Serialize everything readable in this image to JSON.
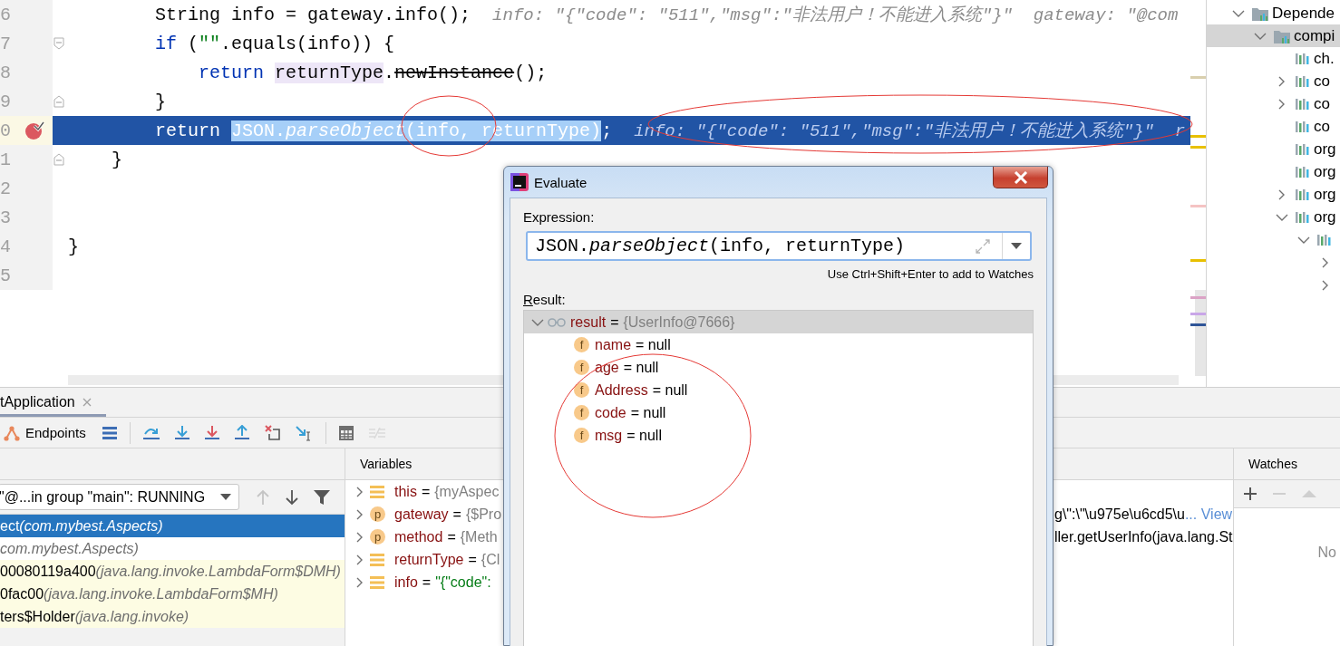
{
  "editor": {
    "lines": [
      {
        "number": "6",
        "current": false,
        "breakpoint": false,
        "fold_open": false,
        "fold_close": false,
        "code": [
          {
            "text": "        String info = gateway.info();",
            "kind": "plain"
          }
        ],
        "hint": "info: \"{\"code\": \"511\",\"msg\":\"非法用户！不能进入系统\"}\"  gateway: \"@com"
      },
      {
        "number": "7",
        "current": false,
        "breakpoint": false,
        "fold_open": true,
        "fold_close": false,
        "code": [
          {
            "text": "        if",
            "kind": "keyword"
          },
          {
            "text": " (",
            "kind": "plain"
          },
          {
            "text": "\"\"",
            "kind": "string"
          },
          {
            "text": ".equals(info)) {",
            "kind": "plain"
          }
        ]
      },
      {
        "number": "8",
        "current": false,
        "breakpoint": false,
        "fold_open": false,
        "fold_close": false,
        "code": [
          {
            "text": "            return ",
            "kind": "keyword"
          },
          {
            "text": "returnType",
            "kind": "usage"
          },
          {
            "text": ".",
            "kind": "plain"
          },
          {
            "text": "newInstance",
            "kind": "deprecated"
          },
          {
            "text": "();",
            "kind": "plain"
          }
        ]
      },
      {
        "number": "9",
        "current": false,
        "breakpoint": false,
        "fold_open": false,
        "fold_close": true,
        "code": [
          {
            "text": "        }",
            "kind": "plain"
          }
        ]
      },
      {
        "number": "0",
        "current": true,
        "breakpoint": true,
        "fold_open": false,
        "fold_close": false,
        "code": [
          {
            "text": "        return ",
            "kind": "keyword"
          },
          {
            "text": "JSON.*parseObject*(info, returnType)",
            "kind": "selection"
          },
          {
            "text": ";",
            "kind": "plain"
          }
        ],
        "hint": "info: \"{\"code\": \"511\",\"msg\":\"非法用户！不能进入系统\"}\"  r"
      },
      {
        "number": "1",
        "current": false,
        "breakpoint": false,
        "fold_open": false,
        "fold_close": true,
        "code": [
          {
            "text": "    }",
            "kind": "plain"
          }
        ]
      },
      {
        "number": "2",
        "current": false,
        "breakpoint": false,
        "fold_open": false,
        "fold_close": false
      },
      {
        "number": "3",
        "current": false,
        "breakpoint": false,
        "fold_open": false,
        "fold_close": false
      },
      {
        "number": "4",
        "current": false,
        "breakpoint": false,
        "fold_open": false,
        "fold_close": false,
        "code": [
          {
            "text": "}",
            "kind": "plain"
          }
        ]
      },
      {
        "number": "5",
        "current": false,
        "breakpoint": false,
        "fold_open": false,
        "fold_close": false
      }
    ]
  },
  "project_tree": {
    "items": [
      {
        "label": "Depende",
        "kind": "folder",
        "expanded": true,
        "selected": false,
        "children": [
          {
            "label": "compi",
            "kind": "folder",
            "expanded": true,
            "selected": true,
            "children": [
              {
                "label": "ch.",
                "kind": "library",
                "selected": false
              },
              {
                "label": "co",
                "kind": "library",
                "expanded": false,
                "selected": false
              },
              {
                "label": "co",
                "kind": "library",
                "expanded": false,
                "selected": false
              },
              {
                "label": "co",
                "kind": "library",
                "selected": false
              },
              {
                "label": "org",
                "kind": "library",
                "selected": false
              },
              {
                "label": "org",
                "kind": "library",
                "selected": false
              },
              {
                "label": "org",
                "kind": "library",
                "expanded": false,
                "selected": false
              },
              {
                "label": "org",
                "kind": "library",
                "expanded": true,
                "selected": false,
                "children": [
                  {
                    "kind": "library",
                    "expanded": true,
                    "selected": false,
                    "children": [
                      {
                        "expanded": false,
                        "selected": false
                      },
                      {
                        "expanded": false,
                        "selected": false
                      }
                    ]
                  }
                ]
              }
            ]
          }
        ]
      }
    ]
  },
  "run_tab": {
    "label": "tApplication"
  },
  "debug_toolbar": [
    {
      "kind": "endpoints",
      "label": "Endpoints",
      "disabled": false
    },
    {
      "kind": "threads",
      "disabled": false
    },
    {
      "kind": "separator"
    },
    {
      "kind": "step_over",
      "disabled": false
    },
    {
      "kind": "step_into",
      "disabled": false
    },
    {
      "kind": "force_step_into",
      "disabled": false
    },
    {
      "kind": "step_out",
      "disabled": false
    },
    {
      "kind": "drop_frame",
      "disabled": false
    },
    {
      "kind": "run_to_cursor",
      "disabled": false
    },
    {
      "kind": "separator"
    },
    {
      "kind": "evaluate",
      "disabled": false
    },
    {
      "kind": "trace",
      "disabled": true
    }
  ],
  "frames": {
    "thread": "\"@...in group \"main\": RUNNING",
    "nav": [
      {
        "kind": "up",
        "disabled": true
      },
      {
        "kind": "down",
        "disabled": false
      },
      {
        "kind": "filter",
        "disabled": false
      }
    ],
    "items": [
      {
        "method": "ect",
        "location": "(com.mybest.Aspects)",
        "kind": "project",
        "selected": true
      },
      {
        "location": "com.mybest.Aspects)",
        "kind": "project",
        "selected": false
      },
      {
        "method": "00080119a400",
        "location": "(java.lang.invoke.LambdaForm$DMH)",
        "kind": "library",
        "selected": false
      },
      {
        "method": "0fac00",
        "location": "(java.lang.invoke.LambdaForm$MH)",
        "kind": "library",
        "selected": false
      },
      {
        "method": "ters$Holder",
        "location": "(java.lang.invoke)",
        "kind": "library",
        "selected": false
      }
    ]
  },
  "variables": {
    "title": "Variables",
    "items": [
      {
        "name": "this",
        "kind": "field",
        "expanded": false,
        "operator": "=",
        "value": "{myAspec",
        "is_string": false
      },
      {
        "name": "gateway",
        "kind": "param",
        "badge": "p",
        "expanded": false,
        "operator": "=",
        "value": "{$Pro",
        "is_string": false,
        "value_tail": "g\\\":\\\"\\u975e\\u6cd5\\u",
        "link": "... View"
      },
      {
        "name": "method",
        "kind": "param",
        "badge": "p",
        "expanded": false,
        "operator": "=",
        "value": "{Meth",
        "is_string": false,
        "value_tail": "ller.getUserInfo(java.lang.St"
      },
      {
        "name": "returnType",
        "kind": "field",
        "expanded": false,
        "operator": "=",
        "value": "{Cl",
        "is_string": false
      },
      {
        "name": "info",
        "kind": "field",
        "expanded": false,
        "operator": "=",
        "value": "\"{\"code\":",
        "is_string": true
      }
    ]
  },
  "watches": {
    "title": "Watches",
    "tools": [
      {
        "kind": "add",
        "disabled": false
      },
      {
        "kind": "remove",
        "disabled": true
      },
      {
        "kind": "up",
        "disabled": true
      }
    ],
    "empty_text": "No"
  },
  "evaluate_dialog": {
    "title": "Evaluate",
    "expression_label": "Expression:",
    "expression": "JSON.*parseObject*(info, returnType)",
    "hint": "Use Ctrl+Shift+Enter to add to Watches",
    "result_label": "Result:",
    "result": {
      "name": "result",
      "operator": "=",
      "value": "{UserInfo@7666}",
      "expanded": true,
      "selected": true,
      "children": [
        {
          "badge": "f",
          "name": "name",
          "value": "= null",
          "selected": false
        },
        {
          "badge": "f",
          "name": "age",
          "value": "= null",
          "selected": false
        },
        {
          "badge": "f",
          "name": "Address",
          "value": "= null",
          "selected": false
        },
        {
          "badge": "f",
          "name": "code",
          "value": "= null",
          "selected": false
        },
        {
          "badge": "f",
          "name": "msg",
          "value": "= null",
          "selected": false
        }
      ]
    }
  }
}
